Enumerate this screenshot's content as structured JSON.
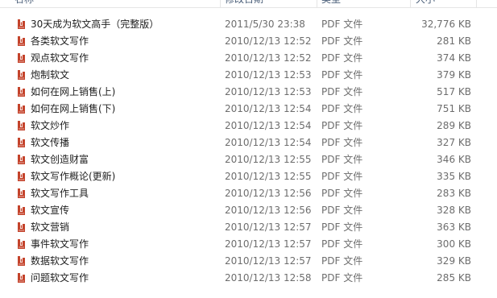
{
  "columns": {
    "name": "名称",
    "date": "修改日期",
    "type": "类型",
    "size": "大小"
  },
  "files": [
    {
      "name": "30天成为软文高手（完整版）",
      "date": "2011/5/30 23:38",
      "type": "PDF 文件",
      "size": "32,776 KB"
    },
    {
      "name": "各类软文写作",
      "date": "2010/12/13 12:52",
      "type": "PDF 文件",
      "size": "281 KB"
    },
    {
      "name": "观点软文写作",
      "date": "2010/12/13 12:52",
      "type": "PDF 文件",
      "size": "374 KB"
    },
    {
      "name": "炮制软文",
      "date": "2010/12/13 12:53",
      "type": "PDF 文件",
      "size": "379 KB"
    },
    {
      "name": "如何在网上销售(上)",
      "date": "2010/12/13 12:53",
      "type": "PDF 文件",
      "size": "517 KB"
    },
    {
      "name": "如何在网上销售(下)",
      "date": "2010/12/13 12:54",
      "type": "PDF 文件",
      "size": "751 KB"
    },
    {
      "name": "软文炒作",
      "date": "2010/12/13 12:54",
      "type": "PDF 文件",
      "size": "289 KB"
    },
    {
      "name": "软文传播",
      "date": "2010/12/13 12:54",
      "type": "PDF 文件",
      "size": "327 KB"
    },
    {
      "name": "软文创造财富",
      "date": "2010/12/13 12:55",
      "type": "PDF 文件",
      "size": "346 KB"
    },
    {
      "name": "软文写作概论(更新)",
      "date": "2010/12/13 12:55",
      "type": "PDF 文件",
      "size": "335 KB"
    },
    {
      "name": "软文写作工具",
      "date": "2010/12/13 12:56",
      "type": "PDF 文件",
      "size": "283 KB"
    },
    {
      "name": "软文宣传",
      "date": "2010/12/13 12:56",
      "type": "PDF 文件",
      "size": "328 KB"
    },
    {
      "name": "软文营销",
      "date": "2010/12/13 12:57",
      "type": "PDF 文件",
      "size": "363 KB"
    },
    {
      "name": "事件软文写作",
      "date": "2010/12/13 12:57",
      "type": "PDF 文件",
      "size": "300 KB"
    },
    {
      "name": "数据软文写作",
      "date": "2010/12/13 12:57",
      "type": "PDF 文件",
      "size": "329 KB"
    },
    {
      "name": "问题软文写作",
      "date": "2010/12/13 12:58",
      "type": "PDF 文件",
      "size": "285 KB"
    }
  ],
  "icon": {
    "name": "pdf-file-icon",
    "color": "#c4432b"
  }
}
